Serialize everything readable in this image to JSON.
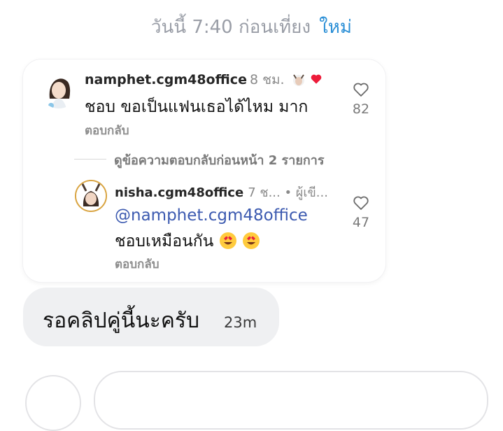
{
  "header": {
    "datetime": "วันนี้ 7:40 ก่อนเที่ยง",
    "new_label": "ใหม่"
  },
  "comment": {
    "username": "namphet.cgm48office",
    "time": "8 ชม.",
    "text": "ชอบ ขอเป็นแฟนเธอได้ไหม มาก",
    "reply_label": "ตอบกลับ",
    "like_count": "82",
    "liked_by_author_icon": "red-heart"
  },
  "view_previous_replies": "ดูข้อความตอบกลับก่อนหน้า 2 รายการ",
  "reply": {
    "username": "nisha.cgm48office",
    "meta": "7 ช... • ผู้เขี...",
    "mention": "@namphet.cgm48office",
    "text": "ชอบเหมือนกัน",
    "emojis": "😍😍",
    "reply_label": "ตอบกลับ",
    "like_count": "47"
  },
  "message": {
    "text": "รอคลิปคู่นี้นะครับ",
    "time": "23m"
  },
  "colors": {
    "accent": "#2b8fd6",
    "mention": "#3c5ab0",
    "bubble": "#eff0f2",
    "heart": "#ed1c3a"
  }
}
